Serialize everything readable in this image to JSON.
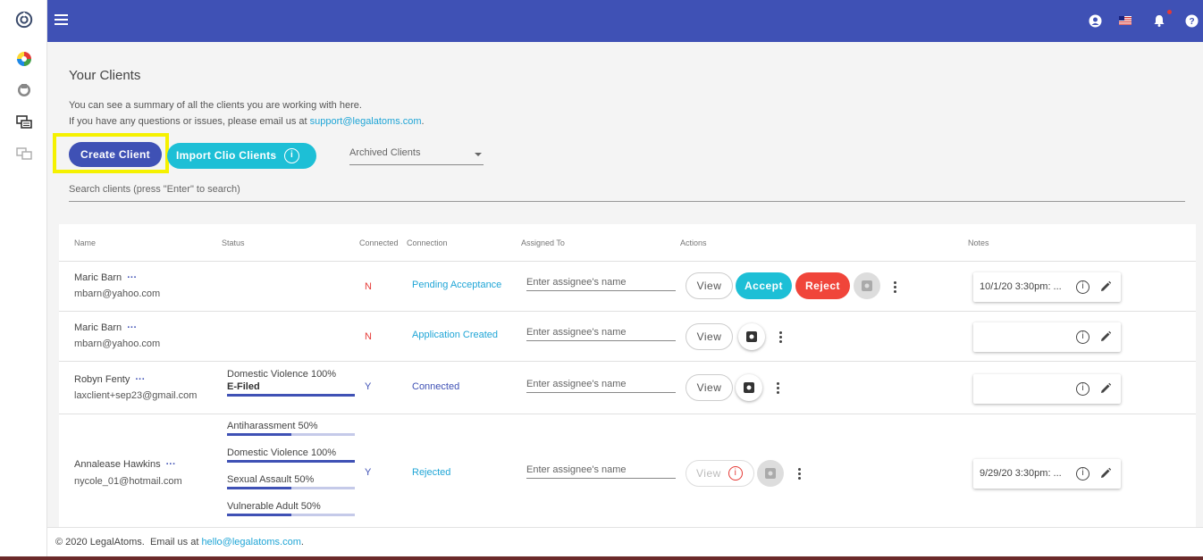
{
  "topbar": {
    "icons": [
      "menu-icon",
      "account-icon",
      "us-flag-icon",
      "notification-bell-icon",
      "help-icon"
    ],
    "notification_dot_color": "#e53935",
    "bar_color": "#3f51b5"
  },
  "rail": {
    "icons": [
      "legalatoms-logo-icon",
      "color-wheel-icon",
      "disk-icon",
      "chat-icon",
      "screens-icon"
    ]
  },
  "page": {
    "title": "Your Clients",
    "intro_line1": "You can see a summary of all the clients you are working with here.",
    "intro_line2_prefix": "If you have any questions or issues, please email us at ",
    "support_email": "support@legalatoms.com",
    "intro_line2_suffix": "."
  },
  "toolbar": {
    "create_label": "Create Client",
    "import_label": "Import Clio Clients",
    "archived_select_value": "Archived Clients",
    "search_placeholder": "Search clients (press \"Enter\" to search)"
  },
  "table": {
    "headers": {
      "name": "Name",
      "status": "Status",
      "connected": "Connected",
      "connection": "Connection",
      "assigned": "Assigned To",
      "actions": "Actions",
      "notes": "Notes"
    },
    "assignee_placeholder": "Enter assignee's name",
    "view_label": "View",
    "accept_label": "Accept",
    "reject_label": "Reject",
    "more_label": "···",
    "rows": [
      {
        "name": "Maric Barn",
        "email": "mbarn@yahoo.com",
        "connected": "N",
        "connection": "Pending Acceptance",
        "note": "10/1/20 3:30pm: ..."
      },
      {
        "name": "Maric Barn",
        "email": "mbarn@yahoo.com",
        "connected": "N",
        "connection": "Application Created",
        "note": ""
      },
      {
        "name": "Robyn Fenty",
        "email": "laxclient+sep23@gmail.com",
        "status": [
          {
            "label": "Domestic Violence 100%",
            "progress": 100
          }
        ],
        "status_extra": "E-Filed",
        "connected": "Y",
        "connection": "Connected",
        "note": ""
      },
      {
        "name": "Annalease Hawkins",
        "email": "nycole_01@hotmail.com",
        "status": [
          {
            "label": "Antiharassment 50%",
            "progress": 50
          },
          {
            "label": "Domestic Violence 100%",
            "progress": 100
          },
          {
            "label": "Sexual Assault 50%",
            "progress": 50
          },
          {
            "label": "Vulnerable Adult 50%",
            "progress": 50
          }
        ],
        "connected": "Y",
        "connection": "Rejected",
        "note": "9/29/20 3:30pm: ..."
      }
    ]
  },
  "footer": {
    "copyright": "© 2020 LegalAtoms.",
    "email_prefix": "Email us at ",
    "email": "hello@legalatoms.com",
    "email_suffix": "."
  },
  "colors": {
    "primary": "#3f51b5",
    "accent": "#1dbfd6",
    "danger": "#f0453a",
    "highlight": "#f5f100",
    "link": "#1fa5d6"
  }
}
